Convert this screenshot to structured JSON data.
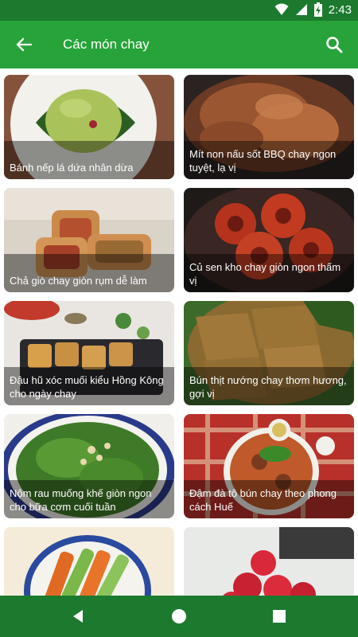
{
  "status": {
    "time": "2:43",
    "icons": [
      "wifi-icon",
      "signal-icon",
      "battery-icon"
    ]
  },
  "appbar": {
    "title": "Các món chay",
    "back_icon": "arrow-back-icon",
    "search_icon": "search-icon"
  },
  "recipes": [
    {
      "title": "Bánh nếp lá dứa nhân dừa"
    },
    {
      "title": "Mít non nấu sốt BBQ chay ngon tuyệt, lạ vị"
    },
    {
      "title": "Chả giò chay giòn rụm dễ làm"
    },
    {
      "title": "Củ sen kho chay giòn ngon thấm vị"
    },
    {
      "title": "Đậu hũ xóc muối kiểu Hồng Kông cho ngày chay"
    },
    {
      "title": "Bún thịt nướng chay thơm hương, gợi vị"
    },
    {
      "title": "Nộm rau muống khế giòn ngon cho bữa cơm cuối tuần"
    },
    {
      "title": "Đậm đà tô bún chay theo phong cách Huế"
    },
    {
      "title": ""
    },
    {
      "title": ""
    }
  ],
  "navbar": {
    "back_icon": "triangle-back-icon",
    "home_icon": "circle-home-icon",
    "recents_icon": "square-recents-icon"
  },
  "colors": {
    "appbar": "#27a339",
    "statusbar": "#1b7a2e",
    "navbar": "#1b7a2e"
  }
}
